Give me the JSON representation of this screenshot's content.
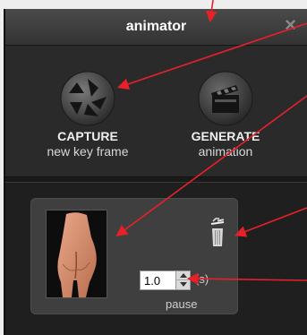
{
  "window": {
    "title": "animator",
    "close_symbol": "×"
  },
  "toolbar": {
    "capture": {
      "label": "CAPTURE",
      "sublabel": "new key frame",
      "icon": "camera-shutter-icon"
    },
    "generate": {
      "label": "GENERATE",
      "sublabel": "animation",
      "icon": "clapperboard-icon"
    }
  },
  "keyframe": {
    "thumbnail": "keyframe-thumbnail",
    "delete_icon": "trash-icon",
    "pause": {
      "value": "1.0",
      "unit": "(s)",
      "label": "pause"
    }
  },
  "colors": {
    "annotation_arrow": "#e8202a",
    "panel_bg": "#2a2a2a",
    "titlebar": "#3c3c3c"
  }
}
